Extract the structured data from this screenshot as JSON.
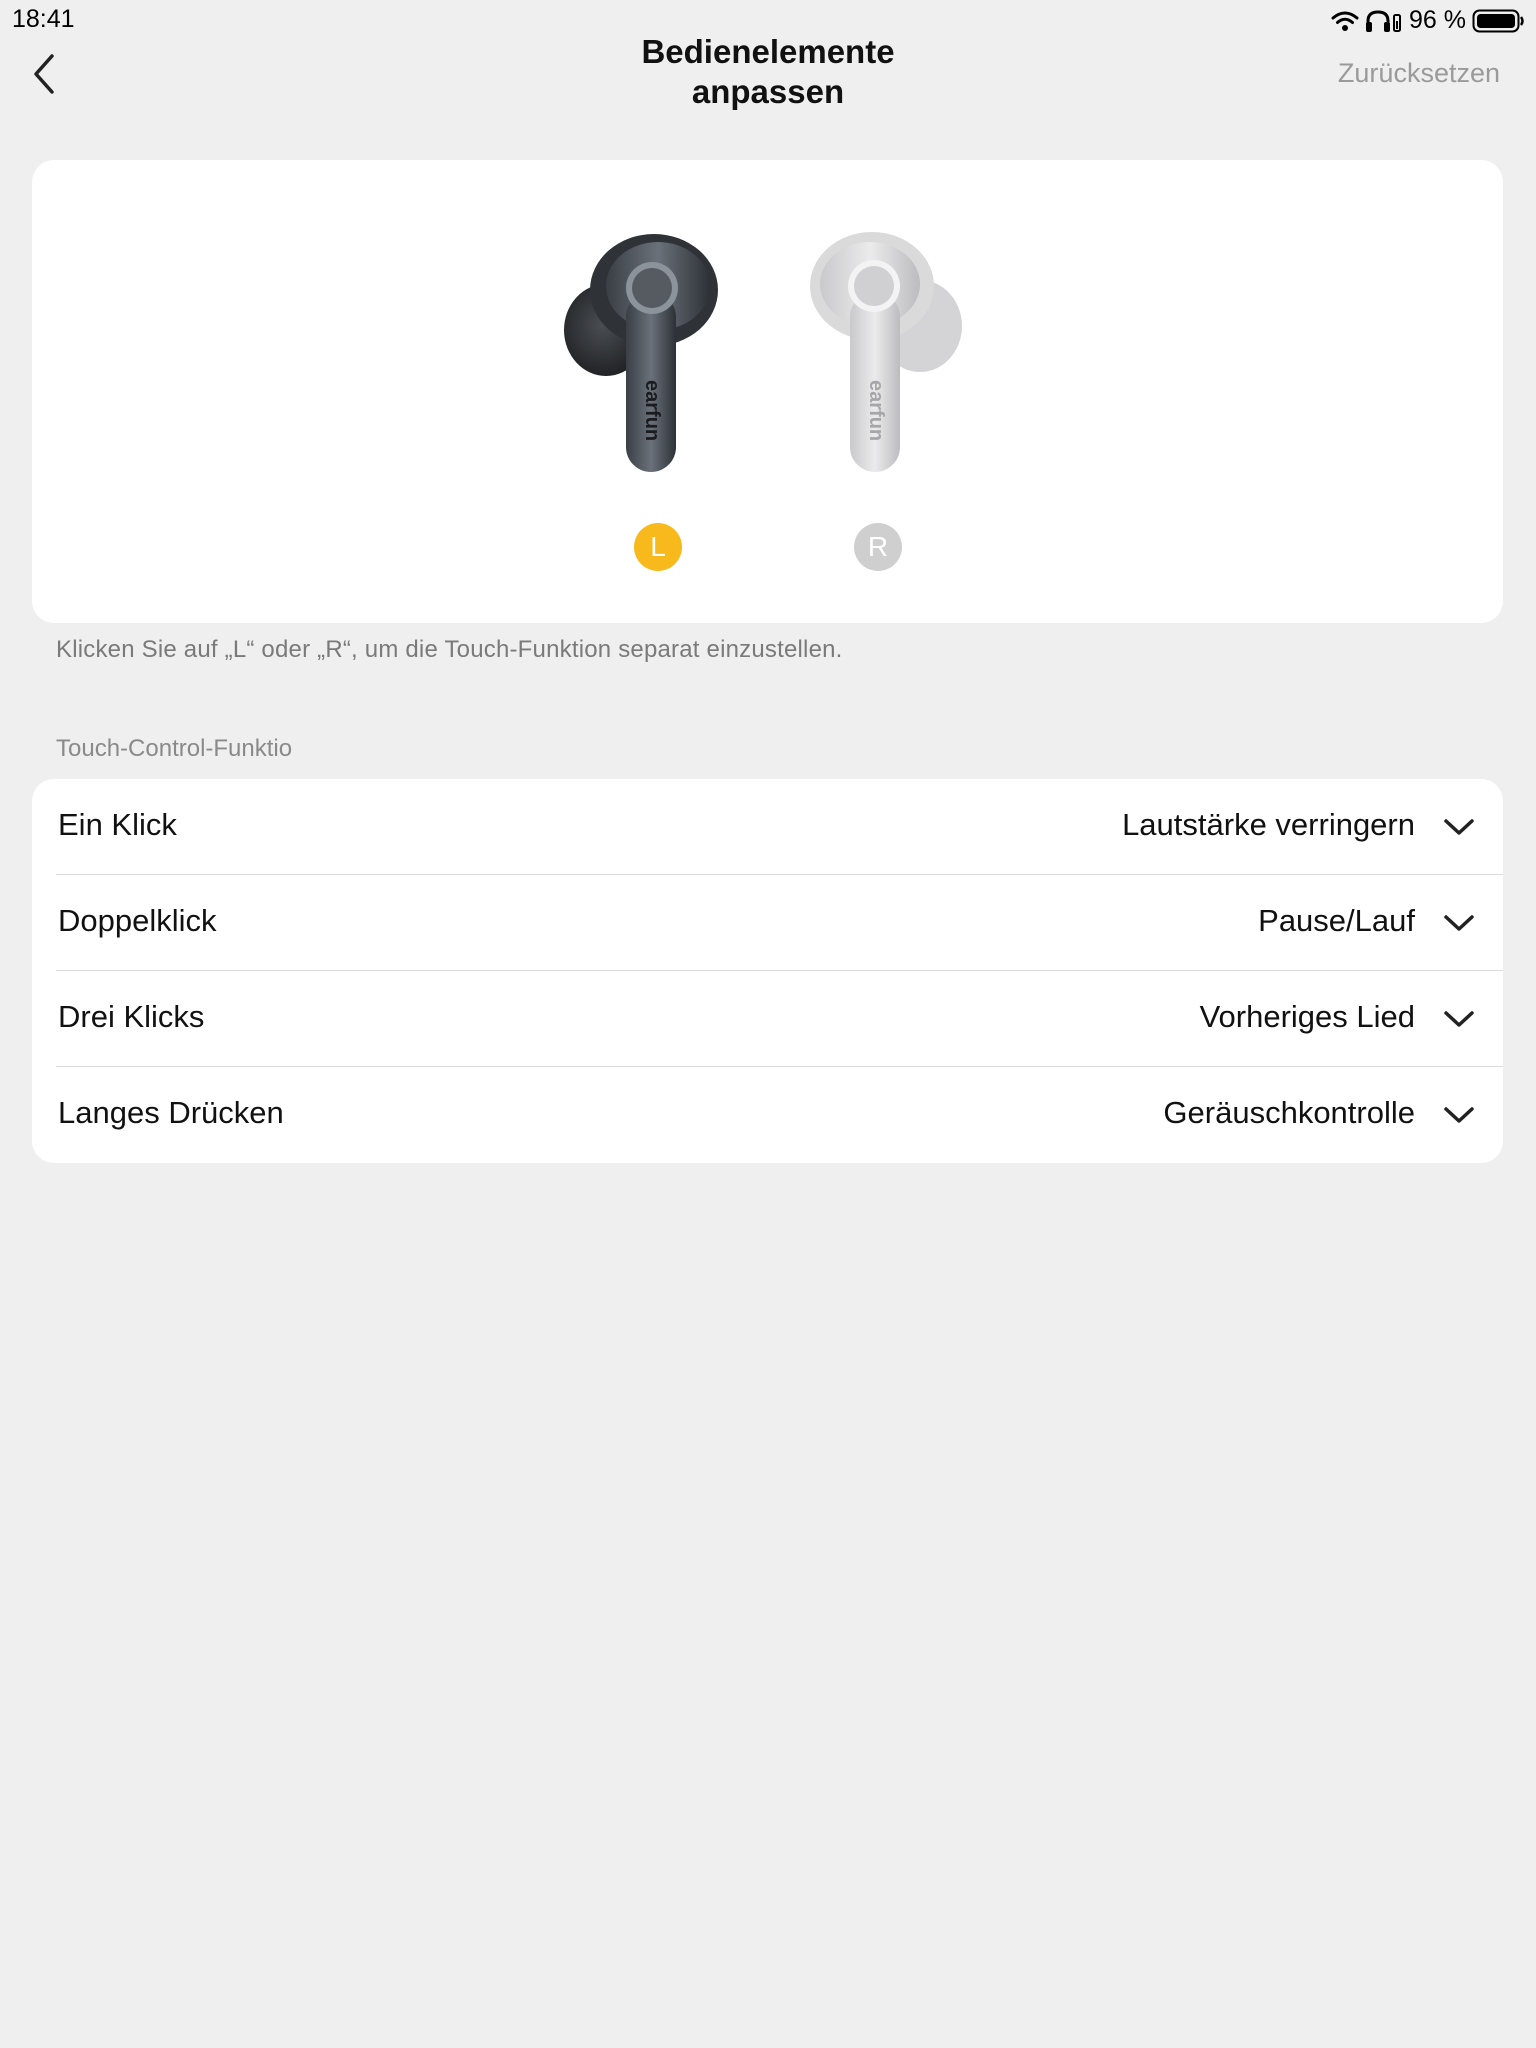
{
  "status_bar": {
    "time": "18:41",
    "battery_text": "96 %",
    "icons": [
      "wifi-icon",
      "headphones-icon",
      "battery-icon"
    ]
  },
  "nav": {
    "title_line1": "Bedienelemente",
    "title_line2": "anpassen",
    "reset_label": "Zurücksetzen",
    "back_icon": "chevron-left-icon"
  },
  "earbuds": {
    "left_label": "L",
    "right_label": "R",
    "brand_text": "earfun",
    "colors": {
      "left_selected": "#f7b91b",
      "right_unselected": "#cfcfcf"
    },
    "selected": "L"
  },
  "hint": "Klicken Sie auf „L“ oder „R“, um die Touch-Funktion separat einzustellen.",
  "section_label": "Touch-Control-Funktio",
  "controls": [
    {
      "label": "Ein Klick",
      "value": "Lautstärke verringern"
    },
    {
      "label": "Doppelklick",
      "value": "Pause/Lauf"
    },
    {
      "label": "Drei Klicks",
      "value": "Vorheriges Lied"
    },
    {
      "label": "Langes Drücken",
      "value": "Geräuschkontrolle"
    }
  ]
}
